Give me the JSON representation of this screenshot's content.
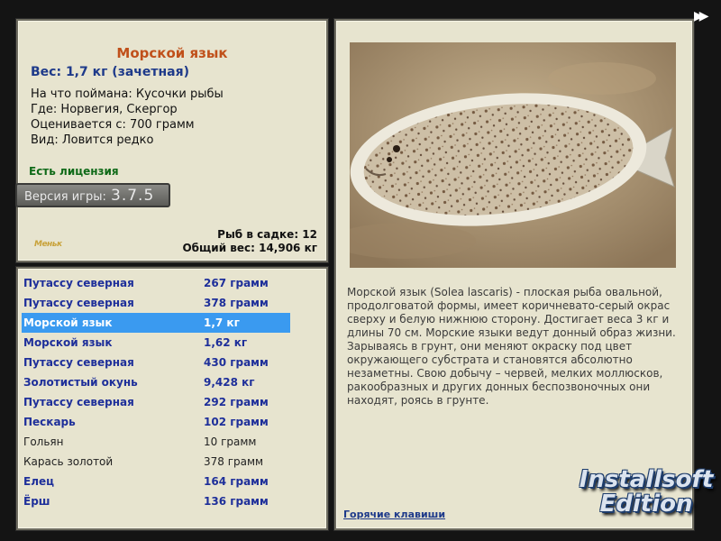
{
  "info": {
    "title": "Морской язык",
    "weight": "Вес: 1,7 кг (зачетная)",
    "lines": [
      "На что поймана: Кусочки рыбы",
      "Где: Норвегия, Скергор",
      "Оценивается с: 700 грамм",
      "Вид: Ловится редко"
    ],
    "license": "Есть лицензия",
    "version_label": "Версия игры:",
    "version_number": "3.7.5",
    "logo_text": "Меньк",
    "fish_in_cage": "Рыб в садке: 12",
    "total_weight": "Общий вес: 14,906 кг"
  },
  "catch_list": [
    {
      "name": "Путассу северная",
      "weight": "267 грамм",
      "style": "trophy"
    },
    {
      "name": "Путассу северная",
      "weight": "378 грамм",
      "style": "trophy"
    },
    {
      "name": "Морской язык",
      "weight": "1,7 кг",
      "style": "selected"
    },
    {
      "name": "Морской язык",
      "weight": "1,62 кг",
      "style": "trophy"
    },
    {
      "name": "Путассу северная",
      "weight": "430 грамм",
      "style": "trophy"
    },
    {
      "name": "Золотистый окунь",
      "weight": "9,428 кг",
      "style": "trophy"
    },
    {
      "name": "Путассу северная",
      "weight": "292 грамм",
      "style": "trophy"
    },
    {
      "name": "Пескарь",
      "weight": "102 грамм",
      "style": "trophy"
    },
    {
      "name": "Гольян",
      "weight": "10 грамм",
      "style": "plain"
    },
    {
      "name": "Карась золотой",
      "weight": "378 грамм",
      "style": "plain"
    },
    {
      "name": "Елец",
      "weight": "164 грамм",
      "style": "trophy"
    },
    {
      "name": "Ёрш",
      "weight": "136 грамм",
      "style": "trophy"
    }
  ],
  "detail": {
    "description": "Морской язык (Solea lascaris) - плоская рыба овальной, продолговатой формы, имеет коричневато-серый окрас сверху и белую нижнюю сторону. Достигает веса 3 кг и длины 70 см. Морские языки ведут донный образ жизни. Зарываясь в грунт, они меняют окраску под цвет окружающего субстрата и становятся абсолютно незаметны. Свою добычу – червей, мелких моллюсков, ракообразных и других донных беспозвоночных они находят, роясь в грунте.",
    "hotkeys": "Горячие клавиши",
    "photo_icon": "sole-fish-photo"
  },
  "nav": {
    "next_icon": "double-arrow-right-icon",
    "next_glyph": "▶▶"
  },
  "watermark": {
    "line1": "Installsoft",
    "line2": "Edition"
  },
  "colors": {
    "panel_bg": "#e7e4cf",
    "title_orange": "#c0501a",
    "link_blue": "#1e3a8a",
    "license_green": "#0f6a18",
    "selection_blue": "#3a9af0"
  }
}
